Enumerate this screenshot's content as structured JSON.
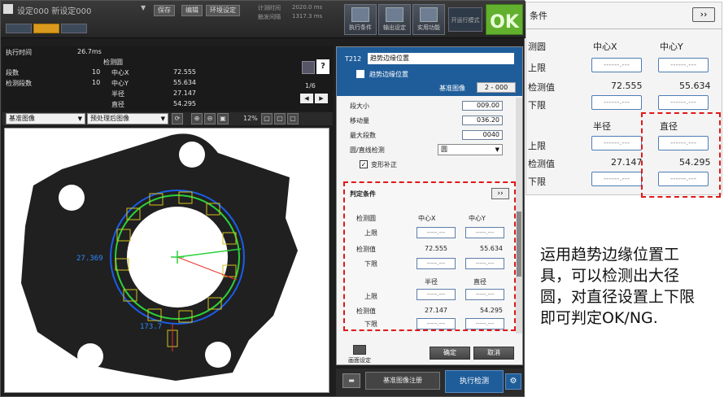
{
  "header": {
    "title": "设定000 新设定000",
    "save_label": "保存",
    "edit_label": "编辑",
    "env_label": "环境设定",
    "measure_time_label": "计测时间",
    "measure_time_value": "2020.0 ms",
    "trigger_label": "触发间隔",
    "trigger_value": "1317.3 ms",
    "tool_buttons": [
      "执行条件",
      "输出设定",
      "实用功能"
    ],
    "run_mode_label": "开运行模式",
    "result": "OK"
  },
  "stats": {
    "exec_time_label": "执行时间",
    "exec_time_value": "26.7ms",
    "circle_label": "检测圆",
    "segments_label": "段数",
    "segments_value": "10",
    "detected_segments_label": "检测段数",
    "detected_segments_value": "10",
    "center_x_label": "中心X",
    "center_x_value": "72.555",
    "center_y_label": "中心Y",
    "center_y_value": "55.634",
    "radius_label": "半径",
    "radius_value": "27.147",
    "diameter_label": "直径",
    "diameter_value": "54.295",
    "page": "1/6"
  },
  "view": {
    "image_select": "基准图像",
    "preprocess_select": "预处理后图像",
    "zoom": "12%",
    "radius_annotation": "27.369",
    "bottom_annotation": "173.7"
  },
  "panel": {
    "tool_id": "T212",
    "tool_name": "趋势边缘位置",
    "tool_sub": "趋势边缘位置",
    "ref_image_label": "基准图像",
    "ref_image_value": "2 - 000",
    "fields": [
      {
        "label": "段大小",
        "value": "009.00"
      },
      {
        "label": "移动量",
        "value": "036.20"
      },
      {
        "label": "最大段数",
        "value": "0040"
      }
    ],
    "circle_detect_label": "圆/直线检测",
    "circle_detect_value": "圆",
    "deform_label": "变形补正",
    "judge_title": "判定条件",
    "judge_more": "››",
    "detect_circle_label": "检测圆",
    "center_x": "中心X",
    "center_y": "中心Y",
    "upper_label": "上限",
    "detected_label": "检测值",
    "lower_label": "下限",
    "radius": "半径",
    "diameter": "直径",
    "cx_value": "72.555",
    "cy_value": "55.634",
    "r_value": "27.147",
    "d_value": "54.295",
    "blank_input": "-----.---",
    "screen_setting": "画面设定",
    "ok_label": "确定",
    "cancel_label": "取消",
    "register_label": "基准图像注册",
    "execute_label": "执行检测"
  },
  "zoom_panel": {
    "title": "条件",
    "more": "››",
    "detect_circle_label": "测圆",
    "center_x": "中心X",
    "center_y": "中心Y",
    "upper_label": "上限",
    "detected_label": "检测值",
    "lower_label": "下限",
    "radius": "半径",
    "diameter": "直径",
    "cx_value": "72.555",
    "cy_value": "55.634",
    "r_value": "27.147",
    "d_value": "54.295",
    "blank_input": "------.---"
  },
  "description": "运用趋势边缘位置工具，可以检测出大径圆，对直径设置上下限即可判定OK/NG."
}
